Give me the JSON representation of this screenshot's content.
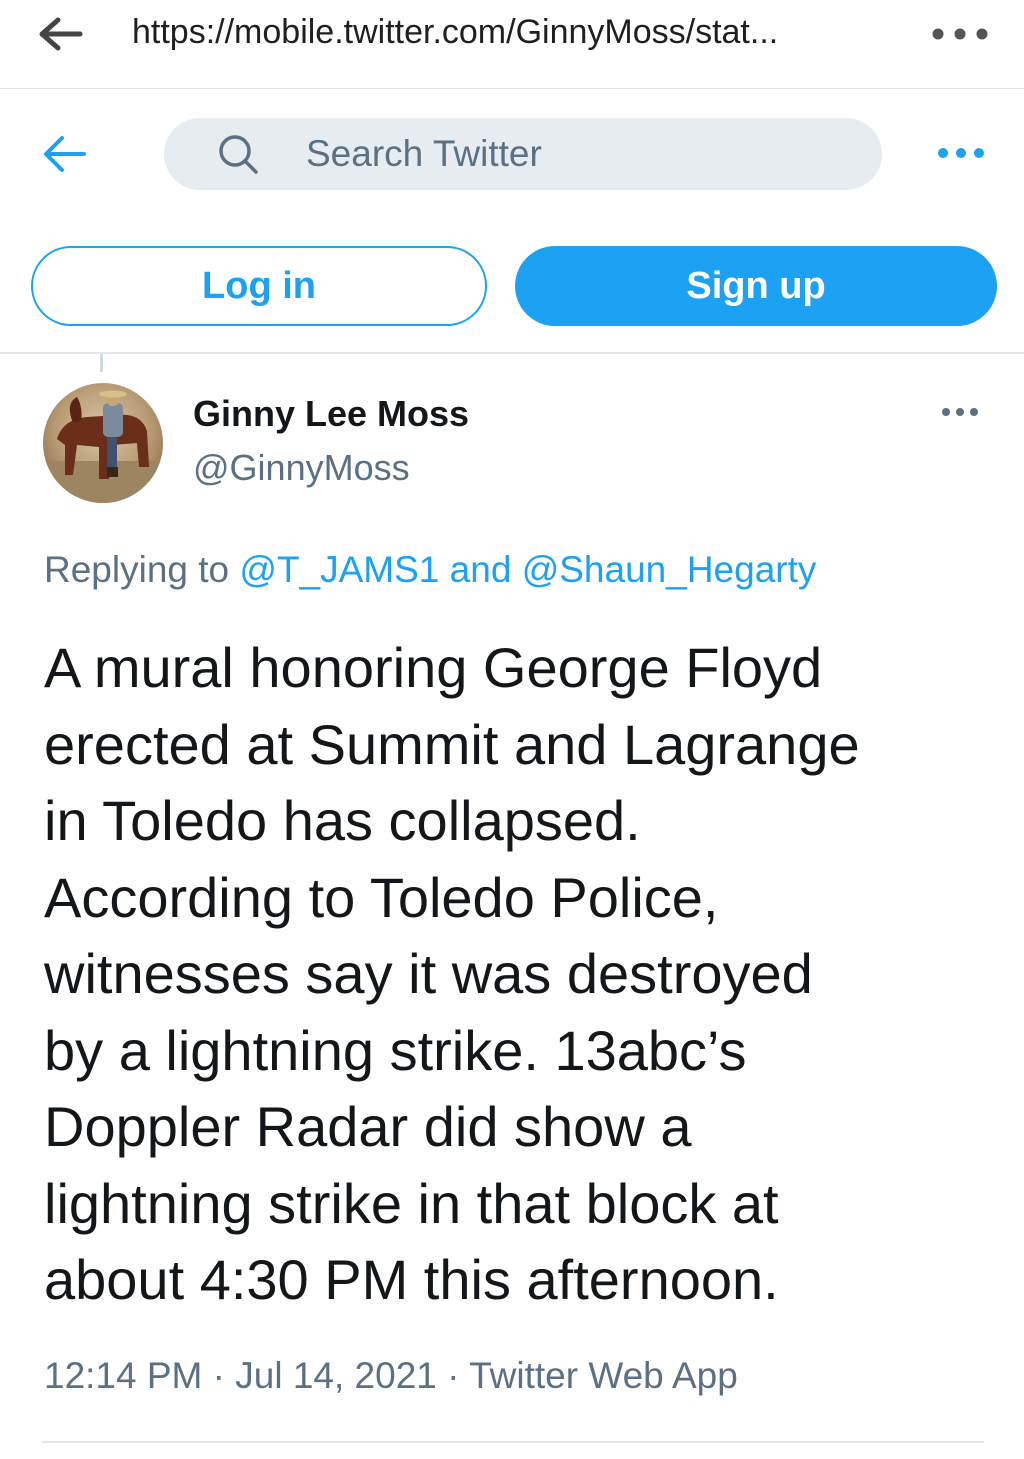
{
  "browser": {
    "url": "https://mobile.twitter.com/GinnyMoss/stat...",
    "back_icon": "arrow-left-icon",
    "menu_icon": "more-dots-icon"
  },
  "header": {
    "back_icon": "arrow-left-icon",
    "search_placeholder": "Search Twitter",
    "search_icon": "search-icon",
    "more_icon": "more-dots-icon",
    "login_label": "Log in",
    "signup_label": "Sign up"
  },
  "tweet": {
    "display_name": "Ginny Lee Moss",
    "handle": "@GinnyMoss",
    "replying_prefix": "Replying to ",
    "replying_to_1": "@T_JAMS1",
    "replying_and": " and ",
    "replying_to_2": "@Shaun_Hegarty",
    "text": "A mural honoring George Floyd\nerected at Summit and Lagrange\nin Toledo has collapsed.\nAccording to Toledo Police,\nwitnesses say it was destroyed\nby a lightning strike. 13abc’s\nDoppler Radar did show a\nlightning strike in that block at\nabout 4:30 PM this afternoon.",
    "time": "12:14 PM",
    "separator": " · ",
    "date": "Jul 14, 2021",
    "source": "Twitter Web App"
  },
  "colors": {
    "accent": "#1da1f2",
    "secondary_text": "#5b7083",
    "search_bg": "#e6ecf0"
  }
}
